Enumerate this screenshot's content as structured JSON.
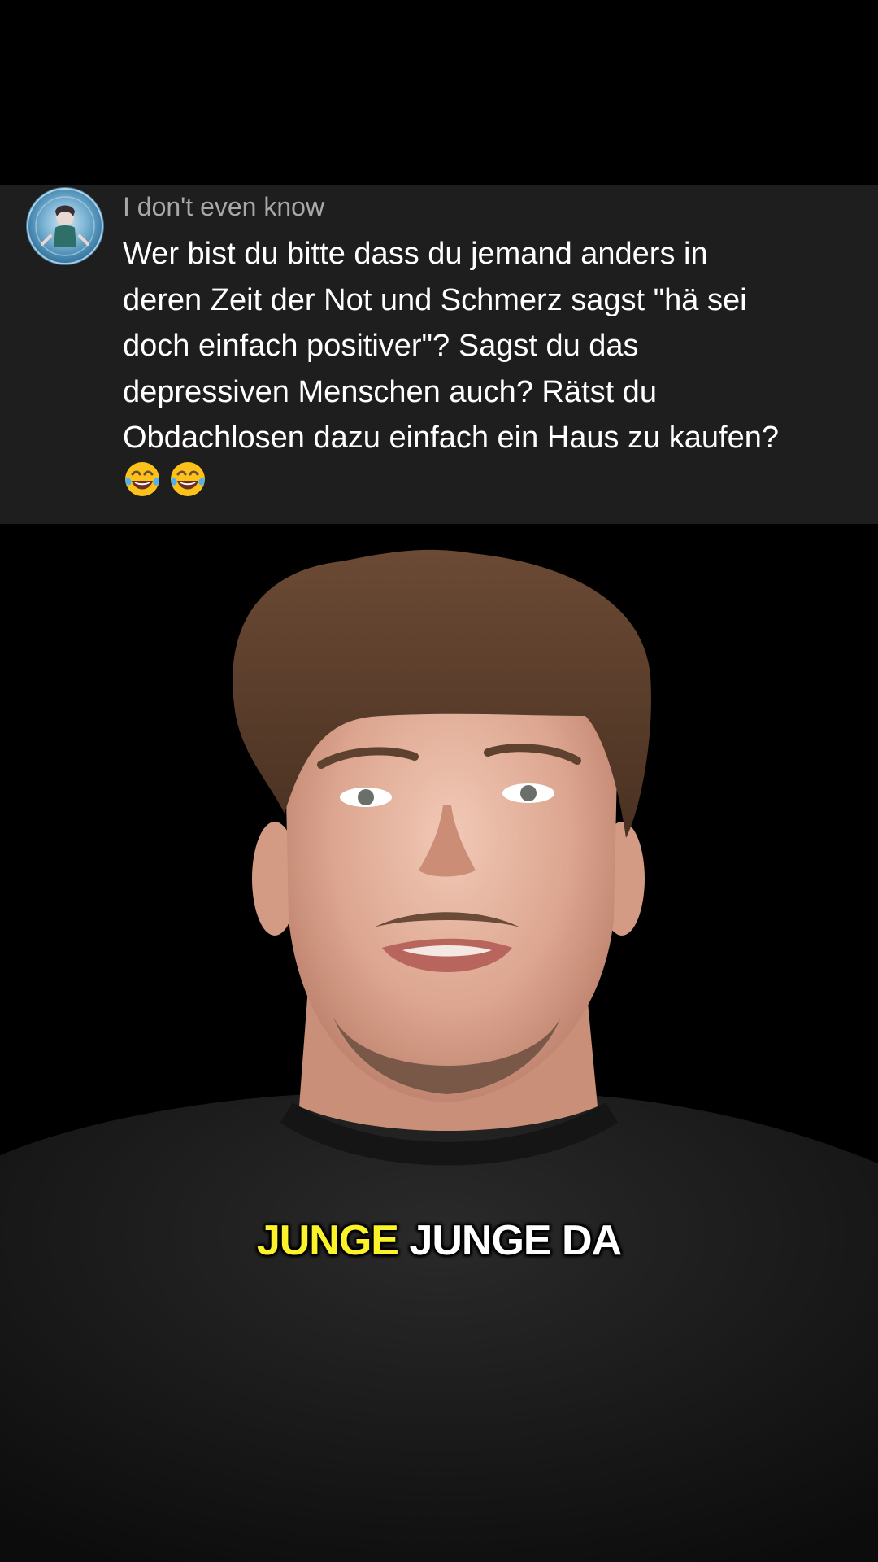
{
  "comment": {
    "username": "I don't even know",
    "text": "Wer bist du bitte dass du jemand anders in\nderen Zeit der Not und Schmerz sagst \"hä sei\ndoch einfach positiver\"? Sagst du das\ndepressiven Menschen auch? Rätst du\nObdachlosen dazu einfach ein Haus zu kaufen?",
    "emojis": [
      "face-with-tears-of-joy-icon",
      "face-with-tears-of-joy-icon"
    ]
  },
  "caption": {
    "highlight_word": "JUNGE",
    "rest": "JUNGE DA",
    "highlight_color": "#fbf22a",
    "text_color": "#ffffff"
  },
  "colors": {
    "background": "#000000",
    "card_background": "#1e1e1e",
    "username": "#a8a8a8",
    "comment_text": "#ffffff"
  }
}
